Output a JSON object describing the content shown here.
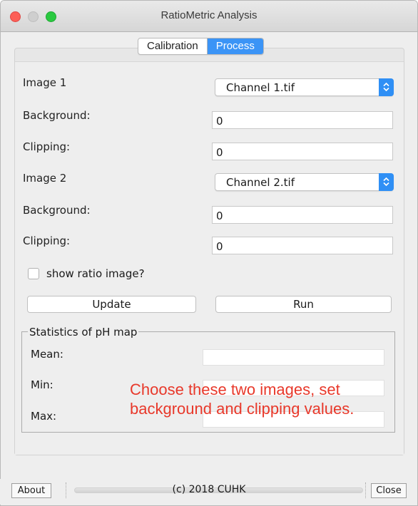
{
  "window": {
    "title": "RatioMetric Analysis"
  },
  "tabs": [
    {
      "label": "Calibration",
      "active": false
    },
    {
      "label": "Process",
      "active": true
    }
  ],
  "image1": {
    "label": "Image 1",
    "selected": "Channel 1.tif",
    "background_label": "Background:",
    "background_value": "0",
    "clipping_label": "Clipping:",
    "clipping_value": "0"
  },
  "image2": {
    "label": "Image 2",
    "selected": "Channel 2.tif",
    "background_label": "Background:",
    "background_value": "0",
    "clipping_label": "Clipping:",
    "clipping_value": "0"
  },
  "show_ratio": {
    "label": "show ratio image?",
    "checked": false
  },
  "buttons": {
    "update": "Update",
    "run": "Run",
    "about": "About",
    "close": "Close"
  },
  "statistics": {
    "title": "Statistics of pH map",
    "mean_label": "Mean:",
    "min_label": "Min:",
    "max_label": "Max:",
    "mean_value": "",
    "min_value": "",
    "max_value": ""
  },
  "annotation": {
    "line1": "Choose these two images, set",
    "line2": "background and clipping values."
  },
  "footer": {
    "copyright": "(c) 2018 CUHK"
  },
  "colors": {
    "accent": "#3b94f6",
    "annotation": "#e8382a"
  }
}
